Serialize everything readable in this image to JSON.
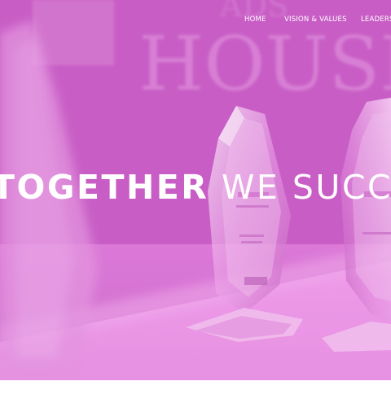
{
  "nav": {
    "items": [
      {
        "label": "HOME"
      },
      {
        "label": "VISION & VALUES"
      },
      {
        "label": "LEADERS"
      }
    ]
  },
  "hero": {
    "headline_bold": "TOGETHER",
    "headline_light": "WE SUCCEED",
    "background_text": "HOUSING"
  },
  "colors": {
    "overlay": "#d06ccd",
    "text": "#ffffff",
    "page_bg": "#ffffff"
  }
}
